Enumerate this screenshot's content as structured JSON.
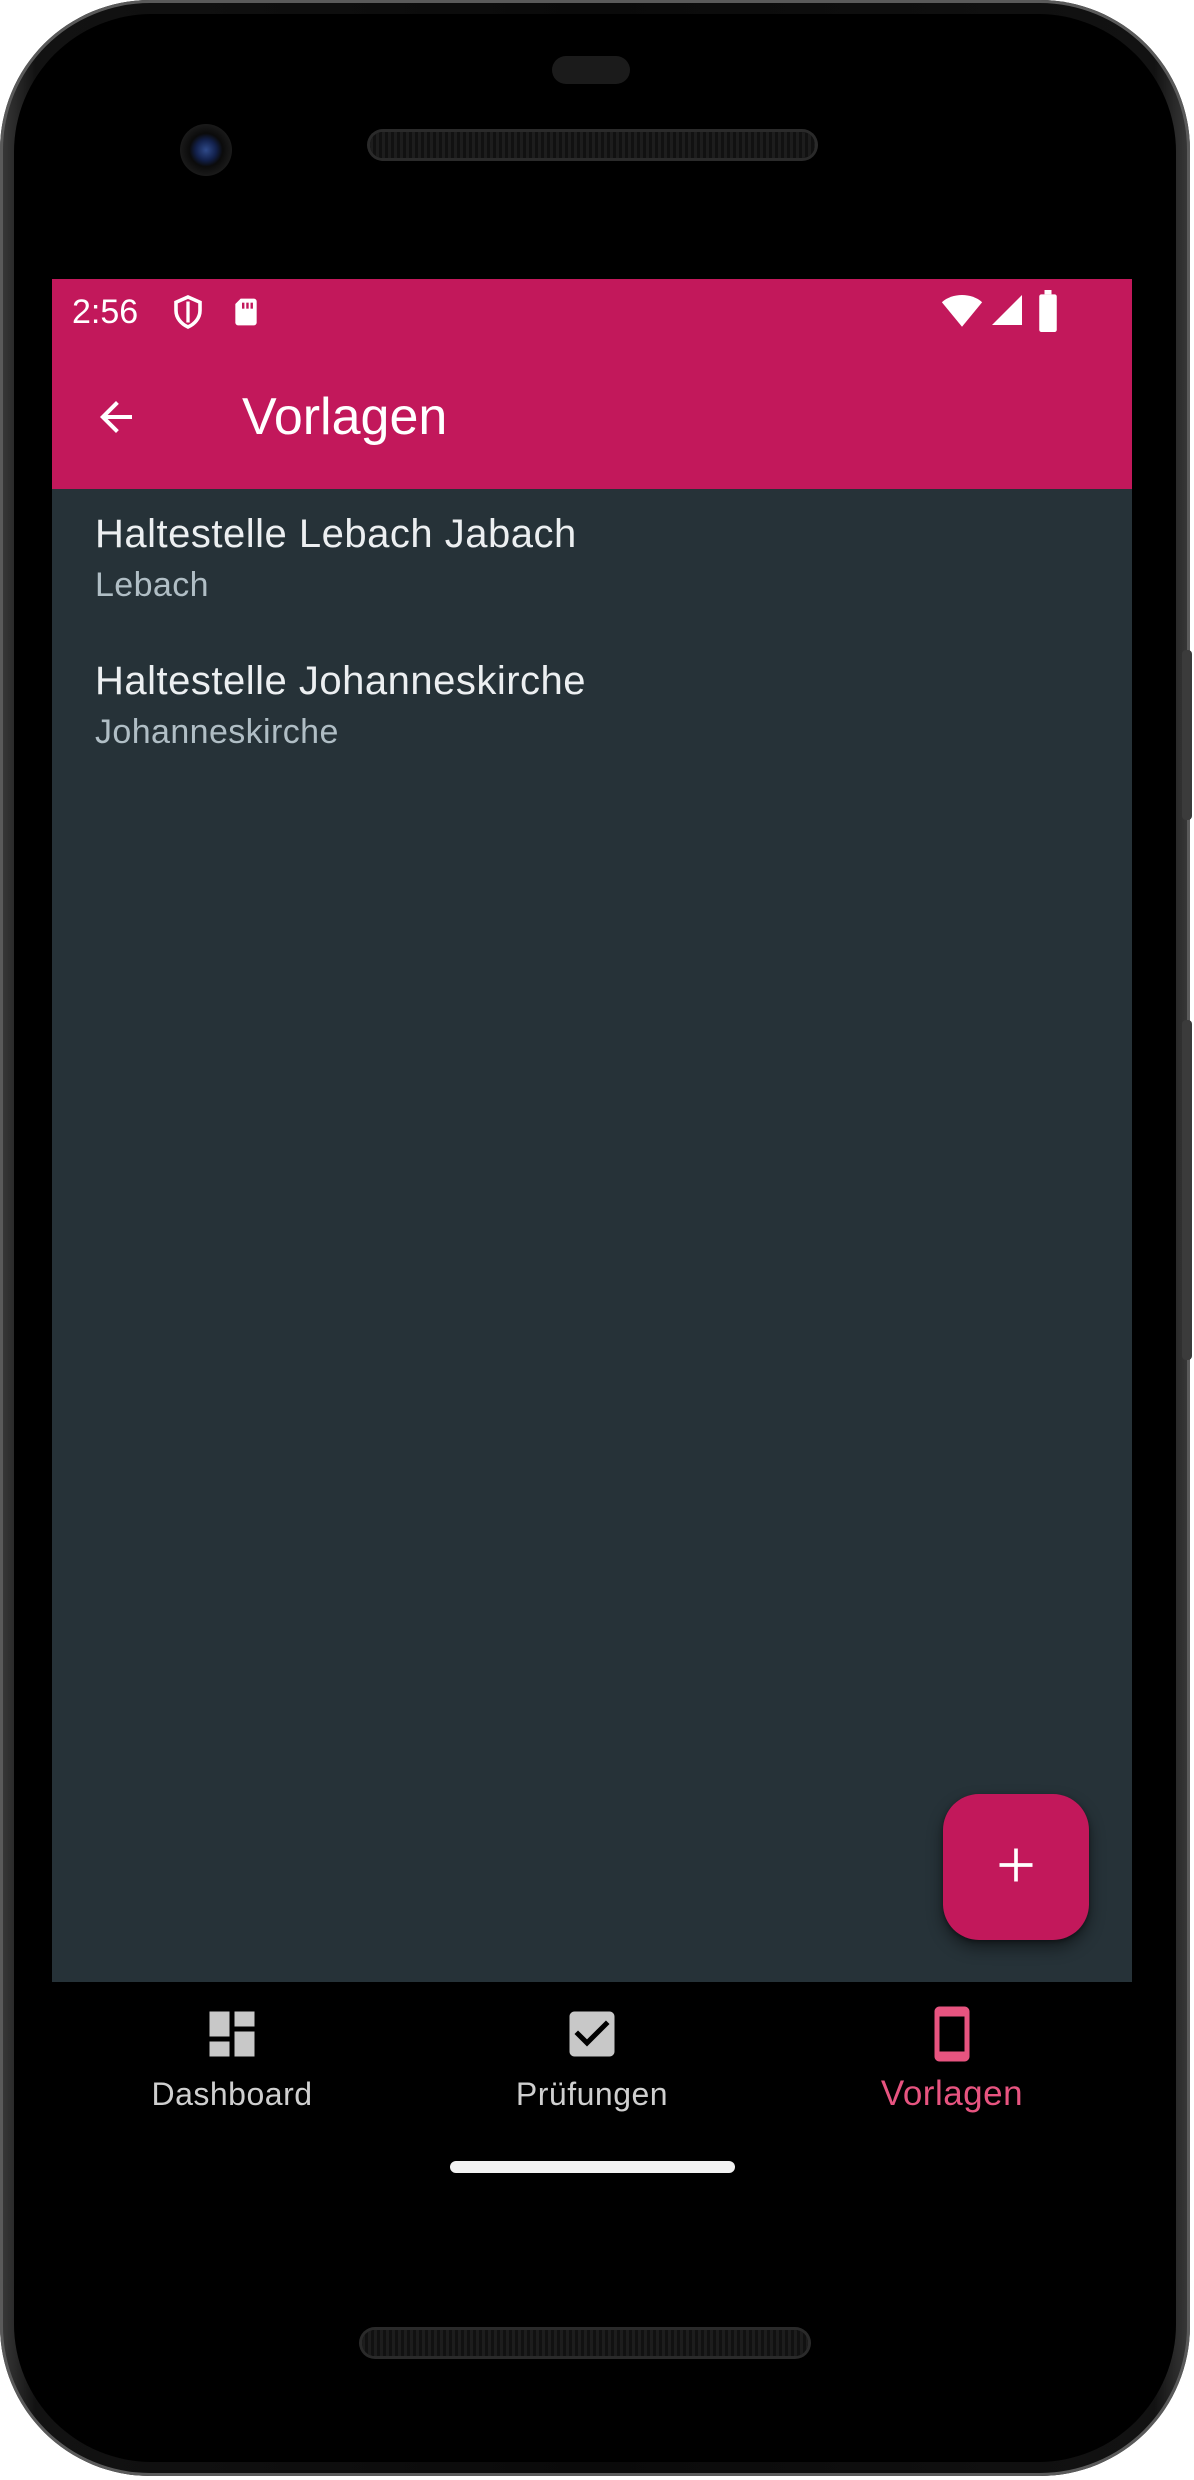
{
  "colors": {
    "primary": "#c2185b",
    "background": "#263238",
    "active_nav": "#e75480",
    "inactive_nav": "#cfcfcf"
  },
  "status_bar": {
    "time": "2:56",
    "icons": [
      "shield-icon",
      "sd-card-icon",
      "wifi-icon",
      "cell-signal-icon",
      "battery-icon"
    ]
  },
  "app_bar": {
    "back_icon": "arrow-back-icon",
    "title": "Vorlagen"
  },
  "list": {
    "items": [
      {
        "title": "Haltestelle Lebach Jabach",
        "subtitle": "Lebach"
      },
      {
        "title": "Haltestelle Johanneskirche",
        "subtitle": "Johanneskirche"
      }
    ]
  },
  "fab": {
    "icon": "plus-icon"
  },
  "bottom_nav": {
    "items": [
      {
        "label": "Dashboard",
        "icon": "dashboard-icon",
        "active": false
      },
      {
        "label": "Prüfungen",
        "icon": "checkbox-icon",
        "active": false
      },
      {
        "label": "Vorlagen",
        "icon": "phone-icon",
        "active": true
      }
    ]
  }
}
